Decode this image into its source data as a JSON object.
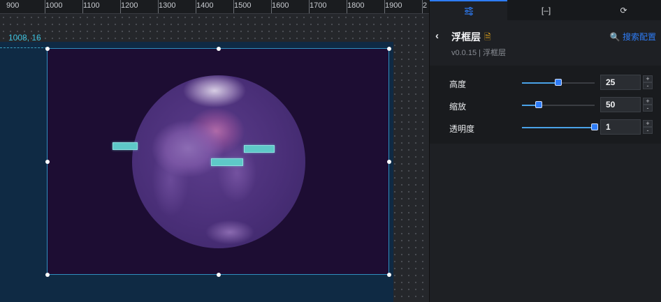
{
  "ruler": {
    "ticks": [
      "900",
      "1000",
      "1100",
      "1200",
      "1300",
      "1400",
      "1500",
      "1600",
      "1700",
      "1800",
      "1900",
      "2"
    ]
  },
  "canvas": {
    "coord_label": "1008, 16"
  },
  "panel": {
    "tabs": [
      {
        "icon": "sliders-icon",
        "glyph": "⚙"
      },
      {
        "icon": "bracket-icon",
        "glyph": "[–]"
      },
      {
        "icon": "refresh-icon",
        "glyph": "⟳"
      }
    ],
    "back_glyph": "‹",
    "title": "浮框层",
    "doc_glyph": "🗎",
    "search_label": "🔍 搜索配置",
    "version": "v0.0.15 | 浮框层",
    "props": [
      {
        "label": "高度",
        "value": "25",
        "level": 0.5
      },
      {
        "label": "缩放",
        "value": "50",
        "level": 0.23
      },
      {
        "label": "透明度",
        "value": "1",
        "level": 1.0
      }
    ],
    "step_up": "+",
    "step_down": "-"
  },
  "colors": {
    "accent": "#2e7cf6",
    "selection": "#2f8fbf",
    "coord": "#3cc2e0"
  }
}
